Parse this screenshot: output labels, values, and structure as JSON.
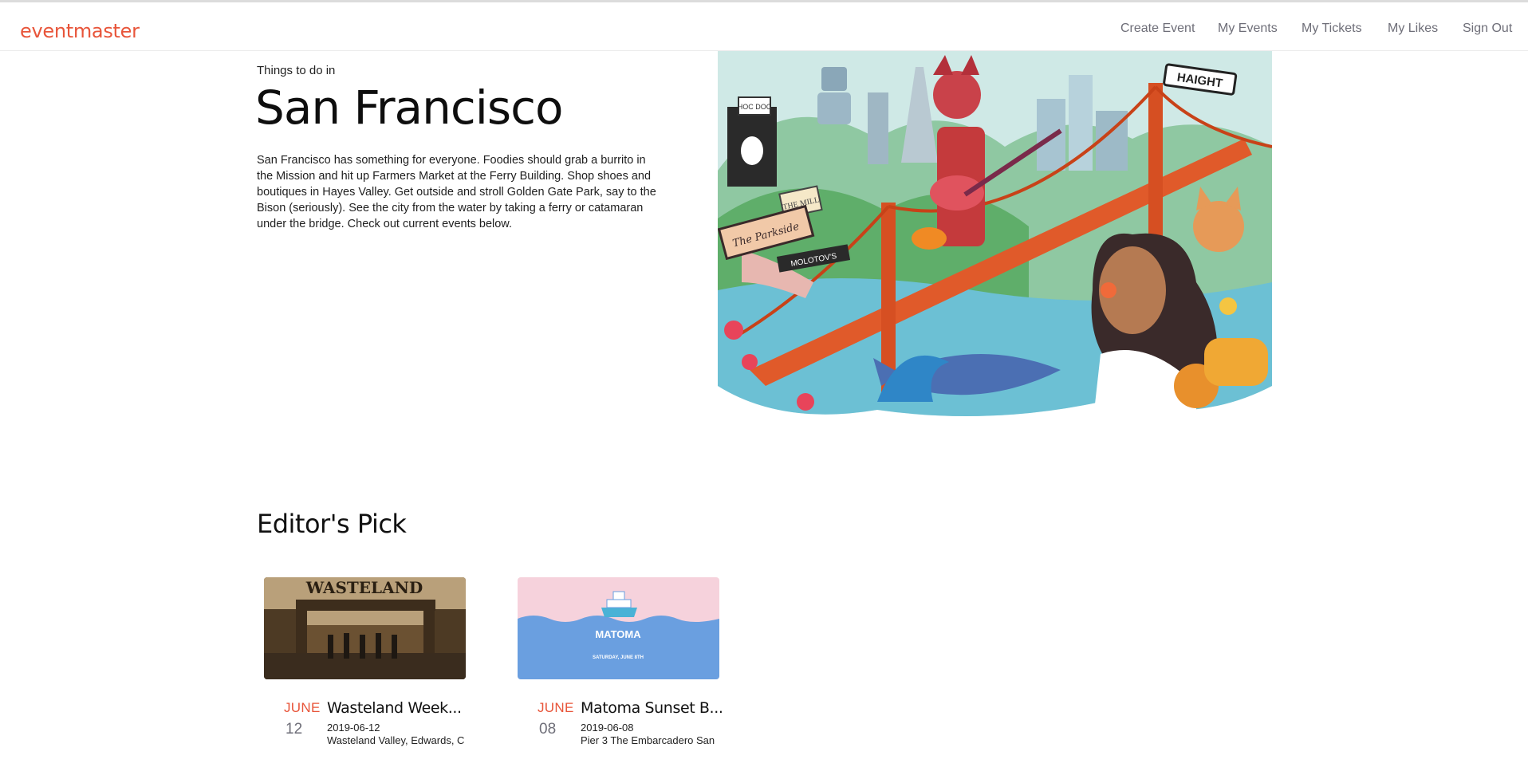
{
  "app": {
    "logo": "eventmaster"
  },
  "nav": {
    "create_event": "Create Event",
    "my_events": "My Events",
    "my_tickets": "My Tickets",
    "my_likes": "My Likes",
    "sign_out": "Sign Out"
  },
  "hero": {
    "eyebrow": "Things to do in",
    "city": "San Francisco",
    "description": "San Francisco has something for everyone. Foodies should grab a burrito in the Mission and hit up Farmers Market at the Ferry Building. Shop shoes and boutiques in Hayes Valley. Get outside and stroll Golden Gate Park, say to the Bison (seriously). See the city from the water by taking a ferry or catamaran under the bridge. Check out current events below.",
    "illustration_signs": [
      "HAIGHT",
      "THE MILL",
      "The Parkside",
      "MOLOTOV'S",
      "HOC DOC"
    ]
  },
  "editors_pick": {
    "title": "Editor's Pick",
    "events": [
      {
        "month": "JUNE",
        "day": "12",
        "title": "Wasteland Week...",
        "date": "2019-06-12",
        "venue": "Wasteland Valley, Edwards, C",
        "image_text": "WASTELAND"
      },
      {
        "month": "JUNE",
        "day": "08",
        "title": "Matoma Sunset B...",
        "date": "2019-06-08",
        "venue": "Pier 3 The Embarcadero San",
        "image_text": "MATOMA",
        "image_subtext": "SATURDAY, JUNE 8TH"
      }
    ]
  },
  "colors": {
    "brand": "#e8553a",
    "nav_text": "#6e6e78"
  }
}
